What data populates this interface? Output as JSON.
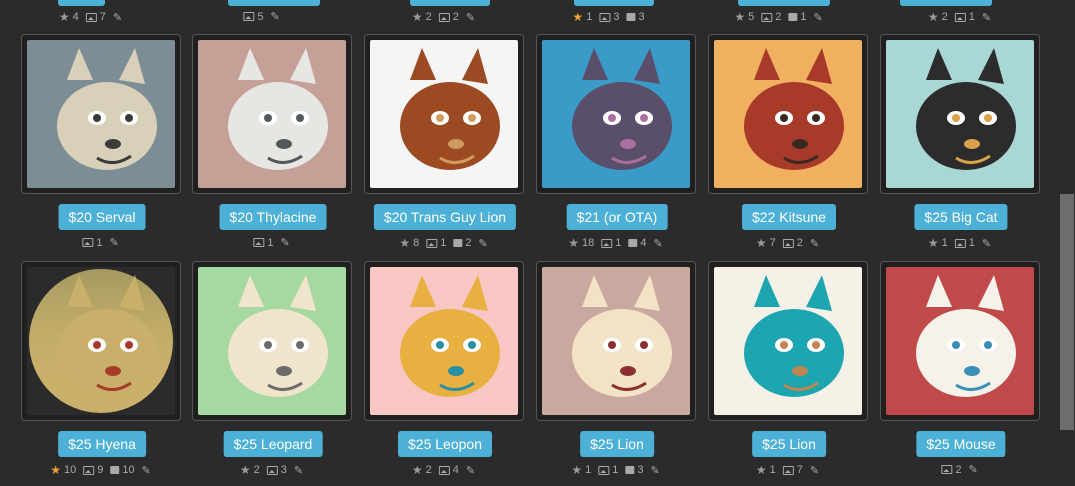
{
  "colors": {
    "background": "#2b2b2b",
    "button": "#4db0d6",
    "favorite_star": "#f0a030"
  },
  "top_row": [
    {
      "stats": [
        {
          "icon": "star-icon",
          "value": "4"
        },
        {
          "icon": "image-icon",
          "value": "7"
        },
        {
          "icon": "pencil-icon",
          "value": ""
        }
      ]
    },
    {
      "stats": [
        {
          "icon": "image-icon",
          "value": "5"
        },
        {
          "icon": "pencil-icon",
          "value": ""
        }
      ]
    },
    {
      "stats": [
        {
          "icon": "star-icon",
          "value": "2"
        },
        {
          "icon": "image-icon",
          "value": "2"
        },
        {
          "icon": "pencil-icon",
          "value": ""
        }
      ]
    },
    {
      "stats": [
        {
          "icon": "star-fav-icon",
          "value": "1"
        },
        {
          "icon": "image-icon",
          "value": "3"
        },
        {
          "icon": "comment-icon",
          "value": "3"
        }
      ]
    },
    {
      "stats": [
        {
          "icon": "star-icon",
          "value": "5"
        },
        {
          "icon": "image-icon",
          "value": "2"
        },
        {
          "icon": "comment-icon",
          "value": "1"
        },
        {
          "icon": "pencil-icon",
          "value": ""
        }
      ]
    },
    {
      "stats": [
        {
          "icon": "star-icon",
          "value": "2"
        },
        {
          "icon": "image-icon",
          "value": "1"
        },
        {
          "icon": "pencil-icon",
          "value": ""
        }
      ]
    }
  ],
  "items": [
    {
      "label": "$20 Serval",
      "stats": [
        {
          "icon": "image-icon",
          "value": "1"
        },
        {
          "icon": "pencil-icon",
          "value": ""
        }
      ]
    },
    {
      "label": "$20 Thylacine",
      "stats": [
        {
          "icon": "image-icon",
          "value": "1"
        },
        {
          "icon": "pencil-icon",
          "value": ""
        }
      ]
    },
    {
      "label": "$20 Trans Guy Lion",
      "stats": [
        {
          "icon": "star-icon",
          "value": "8"
        },
        {
          "icon": "image-icon",
          "value": "1"
        },
        {
          "icon": "comment-icon",
          "value": "2"
        },
        {
          "icon": "pencil-icon",
          "value": ""
        }
      ]
    },
    {
      "label": "$21 (or OTA)",
      "stats": [
        {
          "icon": "star-icon",
          "value": "18"
        },
        {
          "icon": "image-icon",
          "value": "1"
        },
        {
          "icon": "comment-icon",
          "value": "4"
        },
        {
          "icon": "pencil-icon",
          "value": ""
        }
      ]
    },
    {
      "label": "$22 Kitsune",
      "stats": [
        {
          "icon": "star-icon",
          "value": "7"
        },
        {
          "icon": "image-icon",
          "value": "2"
        },
        {
          "icon": "pencil-icon",
          "value": ""
        }
      ]
    },
    {
      "label": "$25 Big Cat",
      "stats": [
        {
          "icon": "star-icon",
          "value": "1"
        },
        {
          "icon": "image-icon",
          "value": "1"
        },
        {
          "icon": "pencil-icon",
          "value": ""
        }
      ]
    },
    {
      "label": "$25 Hyena",
      "stats": [
        {
          "icon": "star-fav-icon",
          "value": "10"
        },
        {
          "icon": "image-icon",
          "value": "9"
        },
        {
          "icon": "comment-icon",
          "value": "10"
        },
        {
          "icon": "pencil-icon",
          "value": ""
        }
      ]
    },
    {
      "label": "$25 Leopard",
      "stats": [
        {
          "icon": "star-icon",
          "value": "2"
        },
        {
          "icon": "image-icon",
          "value": "3"
        },
        {
          "icon": "pencil-icon",
          "value": ""
        }
      ]
    },
    {
      "label": "$25 Leopon",
      "stats": [
        {
          "icon": "star-icon",
          "value": "2"
        },
        {
          "icon": "image-icon",
          "value": "4"
        },
        {
          "icon": "pencil-icon",
          "value": ""
        }
      ]
    },
    {
      "label": "$25 Lion",
      "stats": [
        {
          "icon": "star-icon",
          "value": "1"
        },
        {
          "icon": "image-icon",
          "value": "1"
        },
        {
          "icon": "comment-icon",
          "value": "3"
        },
        {
          "icon": "pencil-icon",
          "value": ""
        }
      ]
    },
    {
      "label": "$25 Lion",
      "stats": [
        {
          "icon": "star-icon",
          "value": "1"
        },
        {
          "icon": "image-icon",
          "value": "7"
        },
        {
          "icon": "pencil-icon",
          "value": ""
        }
      ]
    },
    {
      "label": "$25 Mouse",
      "stats": [
        {
          "icon": "image-icon",
          "value": "2"
        },
        {
          "icon": "pencil-icon",
          "value": ""
        }
      ]
    }
  ]
}
